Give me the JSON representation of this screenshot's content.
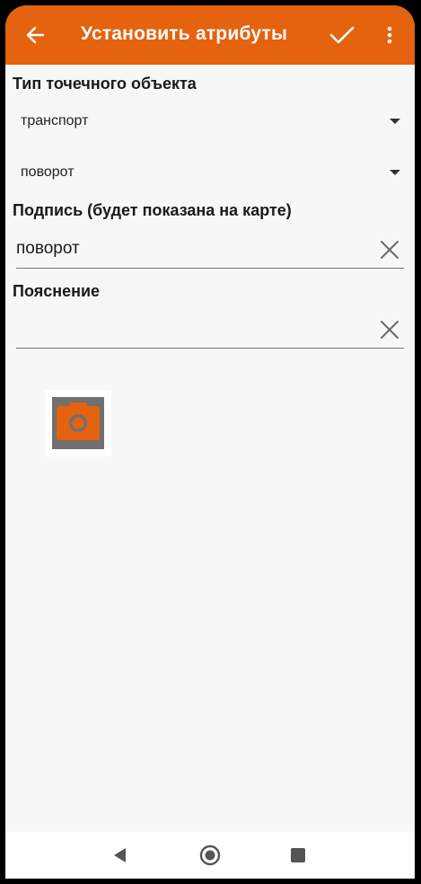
{
  "header": {
    "title": "Установить атрибуты",
    "back_icon": "arrow-back-icon",
    "confirm_icon": "check-icon",
    "menu_icon": "more-vert-icon"
  },
  "type_section": {
    "label": "Тип точечного объекта",
    "category_value": "транспорт",
    "subtype_value": "поворот"
  },
  "caption_section": {
    "label": "Подпись (будет показана на карте)",
    "value": "поворот"
  },
  "note_section": {
    "label": "Пояснение",
    "value": ""
  },
  "photo": {
    "icon": "camera-icon"
  },
  "colors": {
    "accent": "#e5620e",
    "background": "#f7f7f7"
  }
}
